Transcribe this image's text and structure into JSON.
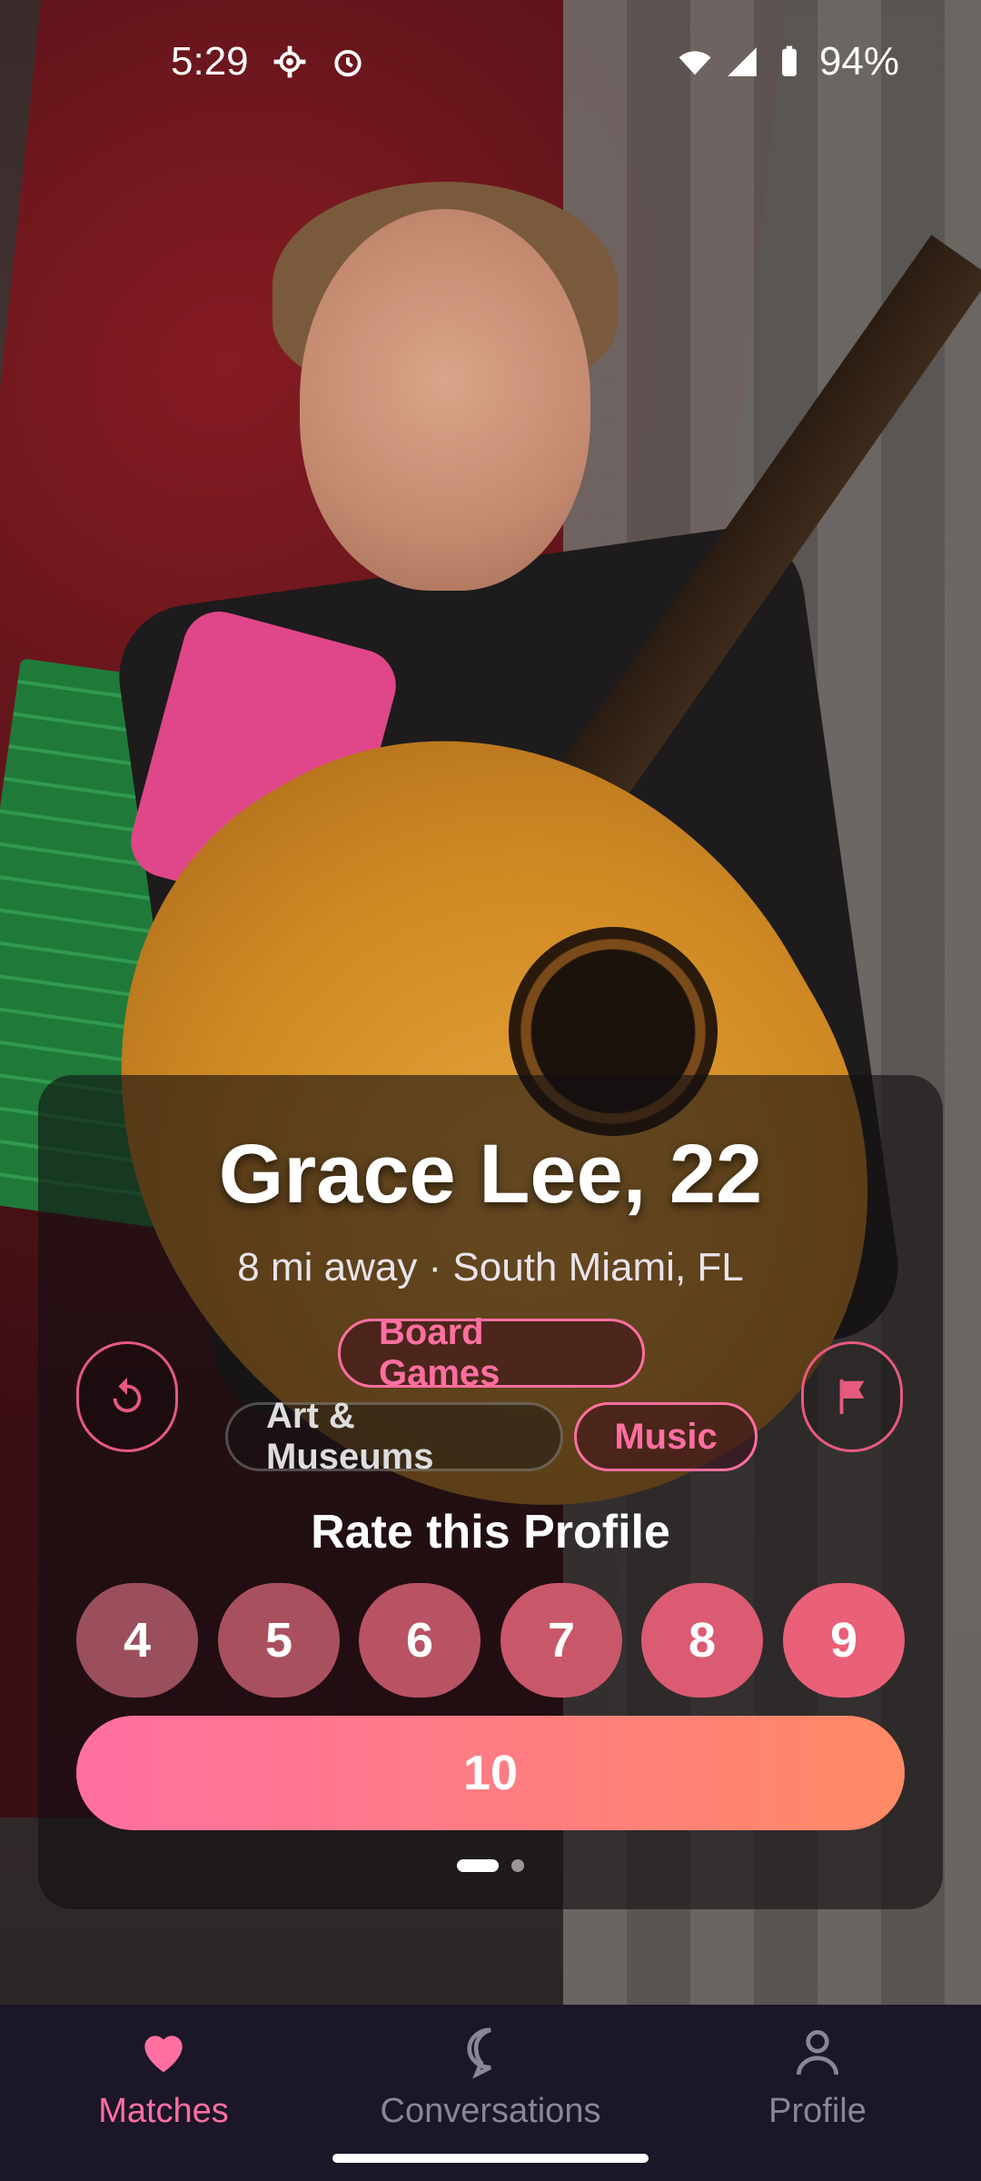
{
  "status_bar": {
    "time": "5:29",
    "battery": "94%",
    "icons": [
      "settings-gear-icon",
      "alarm-icon",
      "wifi-icon",
      "signal-icon",
      "battery-icon"
    ]
  },
  "profile": {
    "name_age": "Grace Lee, 22",
    "meta": "8 mi away · South Miami, FL",
    "interests": [
      {
        "label": "Board Games",
        "style": "pink"
      },
      {
        "label": "Art & Museums",
        "style": "muted"
      },
      {
        "label": "Music",
        "style": "pink"
      }
    ]
  },
  "rating": {
    "title": "Rate this Profile",
    "buttons": [
      "4",
      "5",
      "6",
      "7",
      "8",
      "9"
    ],
    "top_value": "10"
  },
  "nav": {
    "items": [
      {
        "label": "Matches",
        "icon": "heart-icon",
        "active": true
      },
      {
        "label": "Conversations",
        "icon": "chat-bubble-icon",
        "active": false
      },
      {
        "label": "Profile",
        "icon": "person-icon",
        "active": false
      }
    ]
  },
  "colors": {
    "accent_pink": "#ff6fa0",
    "gradient_end": "#ff8a65",
    "nav_bg": "#1b1628"
  }
}
